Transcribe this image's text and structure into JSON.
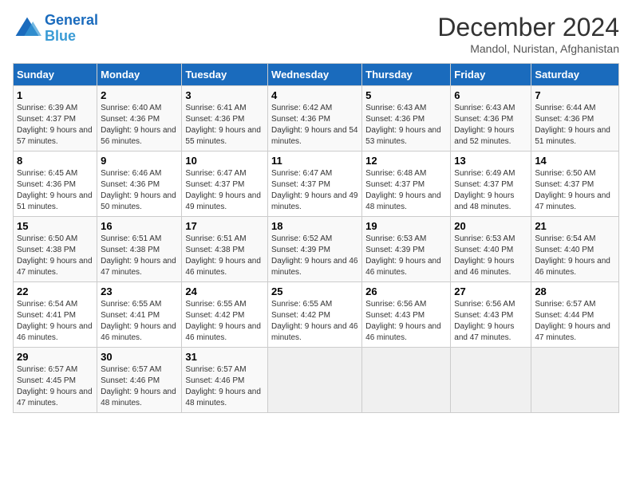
{
  "logo": {
    "line1": "General",
    "line2": "Blue"
  },
  "title": "December 2024",
  "location": "Mandol, Nuristan, Afghanistan",
  "days_of_week": [
    "Sunday",
    "Monday",
    "Tuesday",
    "Wednesday",
    "Thursday",
    "Friday",
    "Saturday"
  ],
  "weeks": [
    [
      {
        "day": "1",
        "sunrise": "6:39 AM",
        "sunset": "4:37 PM",
        "daylight": "9 hours and 57 minutes."
      },
      {
        "day": "2",
        "sunrise": "6:40 AM",
        "sunset": "4:36 PM",
        "daylight": "9 hours and 56 minutes."
      },
      {
        "day": "3",
        "sunrise": "6:41 AM",
        "sunset": "4:36 PM",
        "daylight": "9 hours and 55 minutes."
      },
      {
        "day": "4",
        "sunrise": "6:42 AM",
        "sunset": "4:36 PM",
        "daylight": "9 hours and 54 minutes."
      },
      {
        "day": "5",
        "sunrise": "6:43 AM",
        "sunset": "4:36 PM",
        "daylight": "9 hours and 53 minutes."
      },
      {
        "day": "6",
        "sunrise": "6:43 AM",
        "sunset": "4:36 PM",
        "daylight": "9 hours and 52 minutes."
      },
      {
        "day": "7",
        "sunrise": "6:44 AM",
        "sunset": "4:36 PM",
        "daylight": "9 hours and 51 minutes."
      }
    ],
    [
      {
        "day": "8",
        "sunrise": "6:45 AM",
        "sunset": "4:36 PM",
        "daylight": "9 hours and 51 minutes."
      },
      {
        "day": "9",
        "sunrise": "6:46 AM",
        "sunset": "4:36 PM",
        "daylight": "9 hours and 50 minutes."
      },
      {
        "day": "10",
        "sunrise": "6:47 AM",
        "sunset": "4:37 PM",
        "daylight": "9 hours and 49 minutes."
      },
      {
        "day": "11",
        "sunrise": "6:47 AM",
        "sunset": "4:37 PM",
        "daylight": "9 hours and 49 minutes."
      },
      {
        "day": "12",
        "sunrise": "6:48 AM",
        "sunset": "4:37 PM",
        "daylight": "9 hours and 48 minutes."
      },
      {
        "day": "13",
        "sunrise": "6:49 AM",
        "sunset": "4:37 PM",
        "daylight": "9 hours and 48 minutes."
      },
      {
        "day": "14",
        "sunrise": "6:50 AM",
        "sunset": "4:37 PM",
        "daylight": "9 hours and 47 minutes."
      }
    ],
    [
      {
        "day": "15",
        "sunrise": "6:50 AM",
        "sunset": "4:38 PM",
        "daylight": "9 hours and 47 minutes."
      },
      {
        "day": "16",
        "sunrise": "6:51 AM",
        "sunset": "4:38 PM",
        "daylight": "9 hours and 47 minutes."
      },
      {
        "day": "17",
        "sunrise": "6:51 AM",
        "sunset": "4:38 PM",
        "daylight": "9 hours and 46 minutes."
      },
      {
        "day": "18",
        "sunrise": "6:52 AM",
        "sunset": "4:39 PM",
        "daylight": "9 hours and 46 minutes."
      },
      {
        "day": "19",
        "sunrise": "6:53 AM",
        "sunset": "4:39 PM",
        "daylight": "9 hours and 46 minutes."
      },
      {
        "day": "20",
        "sunrise": "6:53 AM",
        "sunset": "4:40 PM",
        "daylight": "9 hours and 46 minutes."
      },
      {
        "day": "21",
        "sunrise": "6:54 AM",
        "sunset": "4:40 PM",
        "daylight": "9 hours and 46 minutes."
      }
    ],
    [
      {
        "day": "22",
        "sunrise": "6:54 AM",
        "sunset": "4:41 PM",
        "daylight": "9 hours and 46 minutes."
      },
      {
        "day": "23",
        "sunrise": "6:55 AM",
        "sunset": "4:41 PM",
        "daylight": "9 hours and 46 minutes."
      },
      {
        "day": "24",
        "sunrise": "6:55 AM",
        "sunset": "4:42 PM",
        "daylight": "9 hours and 46 minutes."
      },
      {
        "day": "25",
        "sunrise": "6:55 AM",
        "sunset": "4:42 PM",
        "daylight": "9 hours and 46 minutes."
      },
      {
        "day": "26",
        "sunrise": "6:56 AM",
        "sunset": "4:43 PM",
        "daylight": "9 hours and 46 minutes."
      },
      {
        "day": "27",
        "sunrise": "6:56 AM",
        "sunset": "4:43 PM",
        "daylight": "9 hours and 47 minutes."
      },
      {
        "day": "28",
        "sunrise": "6:57 AM",
        "sunset": "4:44 PM",
        "daylight": "9 hours and 47 minutes."
      }
    ],
    [
      {
        "day": "29",
        "sunrise": "6:57 AM",
        "sunset": "4:45 PM",
        "daylight": "9 hours and 47 minutes."
      },
      {
        "day": "30",
        "sunrise": "6:57 AM",
        "sunset": "4:46 PM",
        "daylight": "9 hours and 48 minutes."
      },
      {
        "day": "31",
        "sunrise": "6:57 AM",
        "sunset": "4:46 PM",
        "daylight": "9 hours and 48 minutes."
      },
      null,
      null,
      null,
      null
    ]
  ]
}
